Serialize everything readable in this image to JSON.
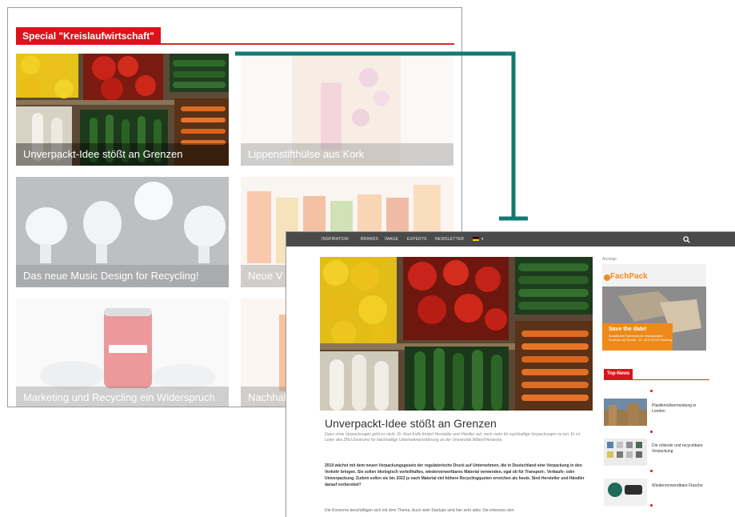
{
  "back_panel": {
    "special_label": "Special \"Kreislaufwirtschaft\"",
    "tiles": [
      {
        "caption": "Unverpackt-Idee stößt an Grenzen"
      },
      {
        "caption": "Lippenstifthülse aus Kork"
      },
      {
        "caption": "Das neue Music Design for Recycling!"
      },
      {
        "caption": "Neue V"
      },
      {
        "caption": "Marketing und Recycling ein Widerspruch"
      },
      {
        "caption": "Nachhal"
      }
    ]
  },
  "front_panel": {
    "nav": {
      "items": [
        "INSPIRATION",
        "BRANDS",
        "IMAGE",
        "EXPERTS",
        "NEWSLETTER"
      ],
      "flag_colors": [
        "#000000",
        "#dd0000",
        "#ffce00"
      ]
    },
    "article": {
      "title": "Unverpackt-Idee stößt an Grenzen",
      "subtitle": "Ganz ohne Verpackungen geht es nicht. Dr. Axel Kolfs fordert Hersteller und Händler auf, noch mehr für nachhaltige Verpackungen zu tun. Er ist Leiter des ZNU-Zentrums für Nachhaltige Unternehmensführung an der Universität Witten/Herdecke.",
      "lead": "2019 wächst mit dem neuen Verpackungsgesetz der regulatorische Druck auf Unternehmen, die in Deutschland eine Verpackung in den Verkehr bringen. Sie sollen ökologisch vorteilhaftes, wiederverwertbares Material verwenden, egal ob für Transport-, Verkaufs- oder Umverpackung. Zudem sollen sie bis 2022 je nach Material viel höhere Recyclingquoten erreichen als heute. Sind Hersteller und Händler darauf vorbereitet?",
      "body": "Die Konzerne beschäftigen sich mit dem Thema. Auch viele Startups sind hier sehr aktiv. Sie erkennen den"
    },
    "ad": {
      "label": "Anzeige",
      "brand": "FachPack",
      "save": "Save the date!",
      "details": "Europäische Fachmesse für Verpackungen, Prozesse und Technik · 24.–26.9.2019 in Nürnberg"
    },
    "top_news": {
      "label": "Top-News",
      "items": [
        {
          "text": "Plastikmüllvermeidung in London"
        },
        {
          "text": "Die rollende und recycelbare Verpackung"
        },
        {
          "text": "Wiederverwendbare Flasche"
        }
      ]
    }
  },
  "colors": {
    "accent_red": "#d9141b",
    "connector_teal": "#0f7a74",
    "nav_bg": "#4a4a4a",
    "ad_orange": "#ee8a1a"
  }
}
